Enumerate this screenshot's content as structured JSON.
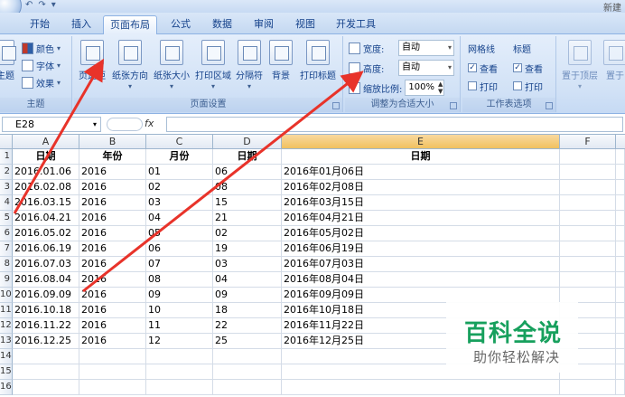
{
  "titlebar": {
    "right_text": "新建",
    "qat": [
      "↶",
      "↷",
      "▾"
    ]
  },
  "tabs": [
    "开始",
    "插入",
    "页面布局",
    "公式",
    "数据",
    "审阅",
    "视图",
    "开发工具"
  ],
  "ribbon": {
    "theme": {
      "colors": "颜色",
      "fonts": "字体",
      "effects": "效果",
      "label": "主题",
      "big": "主题"
    },
    "page_setup": {
      "label": "页面设置",
      "buttons": [
        "页边距",
        "纸张方向",
        "纸张大小",
        "打印区域",
        "分隔符",
        "背景",
        "打印标题"
      ]
    },
    "scale": {
      "label": "调整为合适大小",
      "width_label": "宽度:",
      "width_value": "自动",
      "height_label": "高度:",
      "height_value": "自动",
      "scale_label": "缩放比例:",
      "scale_value": "100%"
    },
    "sheet_options": {
      "label": "工作表选项",
      "gridlines": "网格线",
      "headings": "标题",
      "view": "查看",
      "print": "打印"
    },
    "arrange": {
      "bring_front": "置于顶层",
      "send_back": "置于"
    }
  },
  "formula_bar": {
    "name_box": "E28",
    "fx": "fx",
    "value": ""
  },
  "columns": [
    "A",
    "B",
    "C",
    "D",
    "E",
    "F"
  ],
  "rows": [
    "1",
    "2",
    "3",
    "4",
    "5",
    "6",
    "7",
    "8",
    "9",
    "10",
    "11",
    "12",
    "13",
    "14",
    "15",
    "16"
  ],
  "table": {
    "headers": [
      "日期",
      "年份",
      "月份",
      "日期",
      "日期"
    ],
    "data": [
      [
        "2016.01.06",
        "2016",
        "01",
        "06",
        "2016年01月06日"
      ],
      [
        "2016.02.08",
        "2016",
        "02",
        "08",
        "2016年02月08日"
      ],
      [
        "2016.03.15",
        "2016",
        "03",
        "15",
        "2016年03月15日"
      ],
      [
        "2016.04.21",
        "2016",
        "04",
        "21",
        "2016年04月21日"
      ],
      [
        "2016.05.02",
        "2016",
        "05",
        "02",
        "2016年05月02日"
      ],
      [
        "2016.06.19",
        "2016",
        "06",
        "19",
        "2016年06月19日"
      ],
      [
        "2016.07.03",
        "2016",
        "07",
        "03",
        "2016年07月03日"
      ],
      [
        "2016.08.04",
        "2016",
        "08",
        "04",
        "2016年08月04日"
      ],
      [
        "2016.09.09",
        "2016",
        "09",
        "09",
        "2016年09月09日"
      ],
      [
        "2016.10.18",
        "2016",
        "10",
        "18",
        "2016年10月18日"
      ],
      [
        "2016.11.22",
        "2016",
        "11",
        "22",
        "2016年11月22日"
      ],
      [
        "2016.12.25",
        "2016",
        "12",
        "25",
        "2016年12月25日"
      ]
    ]
  },
  "watermark": {
    "main": "百科全说",
    "sub": "助你轻松解决"
  },
  "colors": {
    "annotation_arrow": "#e8332a",
    "watermark_green": "#17a05d",
    "selected_header": "#f1c15f"
  }
}
